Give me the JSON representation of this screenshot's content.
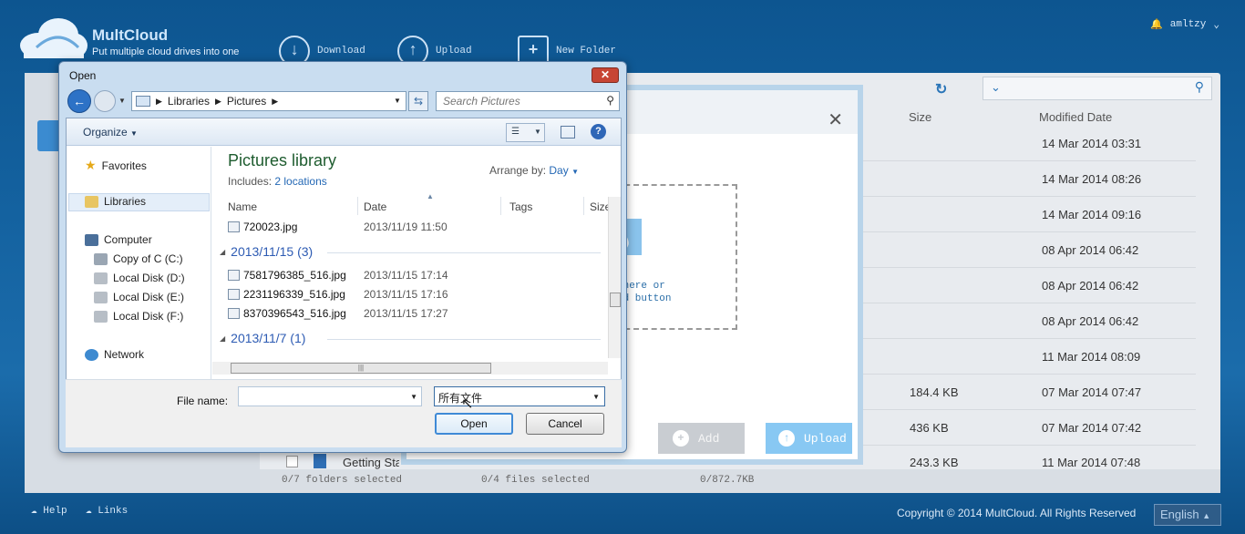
{
  "app": {
    "logo_name": "MultCloud",
    "tagline": "Put multiple cloud drives into one",
    "toolbar": [
      "Download",
      "Upload",
      "New Folder"
    ],
    "user": "amltzy",
    "footer_help": "Help",
    "footer_links": "Links",
    "copyright": "Copyright © 2014 MultCloud. All Rights Reserved",
    "language": "English"
  },
  "filelist": {
    "col_size": "Size",
    "col_modified": "Modified Date",
    "dates": [
      "14 Mar 2014 03:31",
      "14 Mar 2014 08:26",
      "14 Mar 2014 09:16",
      "08 Apr 2014 06:42",
      "08 Apr 2014 06:42",
      "08 Apr 2014 06:42",
      "11 Mar 2014 08:09",
      "07 Mar 2014 07:47",
      "07 Mar 2014 07:42",
      "11 Mar 2014 07:48"
    ],
    "sizes": [
      "",
      "",
      "",
      "",
      "",
      "",
      "",
      "184.4 KB",
      "436 KB",
      "243.3 KB"
    ],
    "partial_item": "Getting Started.pdf",
    "status": {
      "folders": "0/7 folders selected",
      "files": "0/4 files selected",
      "size": "0/872.7KB"
    }
  },
  "upload_modal": {
    "drop_text_line1": "files here or",
    "drop_text_line2": "the Add button",
    "add_label": "Add",
    "upload_label": "Upload"
  },
  "open_dialog": {
    "title": "Open",
    "breadcrumb": [
      "Libraries",
      "Pictures"
    ],
    "search_placeholder": "Search Pictures",
    "organize": "Organize",
    "nav": {
      "favorites": "Favorites",
      "libraries": "Libraries",
      "computer": "Computer",
      "drives": [
        "Copy of C (C:)",
        "Local Disk (D:)",
        "Local Disk (E:)",
        "Local Disk (F:)"
      ],
      "network": "Network"
    },
    "library_title": "Pictures library",
    "includes_label": "Includes:",
    "includes_value": "2 locations",
    "arrange_label": "Arrange by:",
    "arrange_value": "Day",
    "columns": [
      "Name",
      "Date",
      "Tags",
      "Size"
    ],
    "files_top": [
      {
        "name": "720023.jpg",
        "date": "2013/11/19 11:50"
      }
    ],
    "group1": "2013/11/15 (3)",
    "files_group1": [
      {
        "name": "7581796385_516.jpg",
        "date": "2013/11/15 17:14"
      },
      {
        "name": "2231196339_516.jpg",
        "date": "2013/11/15 17:16"
      },
      {
        "name": "8370396543_516.jpg",
        "date": "2013/11/15 17:27"
      }
    ],
    "group2": "2013/11/7 (1)",
    "filename_label": "File name:",
    "filetype_value": "所有文件",
    "open_label": "Open",
    "cancel_label": "Cancel"
  }
}
